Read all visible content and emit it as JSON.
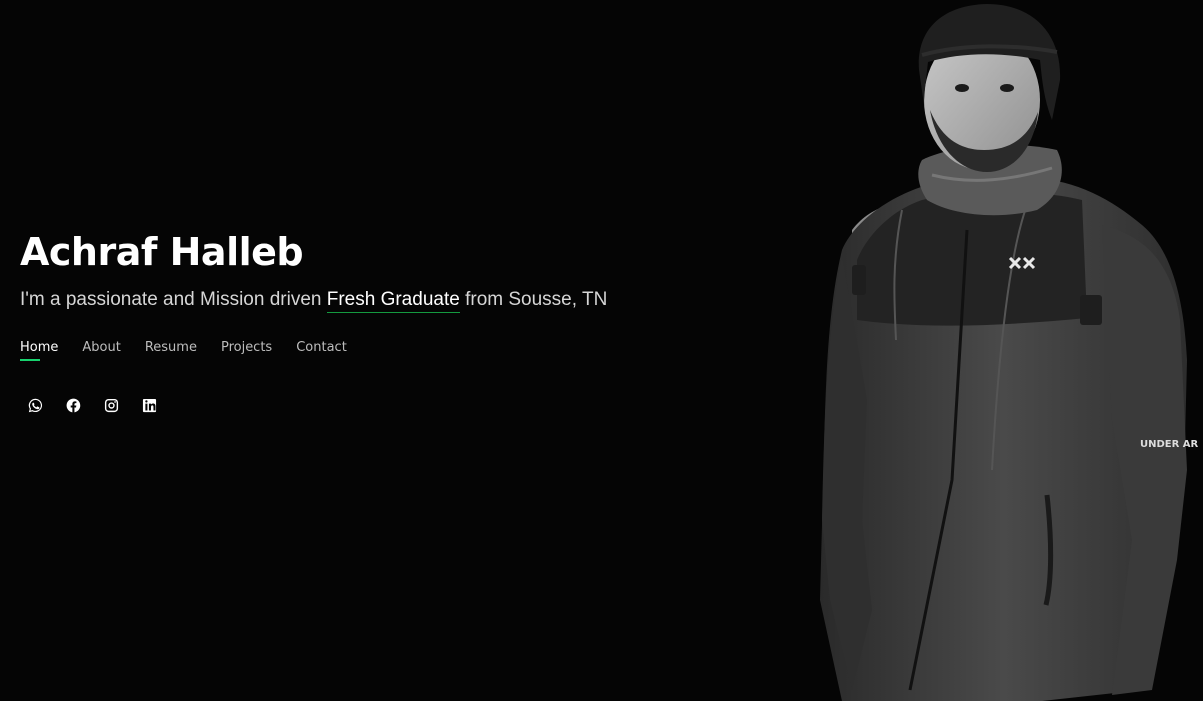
{
  "hero": {
    "name": "Achraf Halleb",
    "tagline_before": "I'm a passionate and Mission driven ",
    "tagline_highlight": "Fresh Graduate",
    "tagline_after": " from Sousse, TN"
  },
  "nav": {
    "items": [
      {
        "label": "Home",
        "active": true
      },
      {
        "label": "About",
        "active": false
      },
      {
        "label": "Resume",
        "active": false
      },
      {
        "label": "Projects",
        "active": false
      },
      {
        "label": "Contact",
        "active": false
      }
    ]
  },
  "social": {
    "icons": [
      "whatsapp-icon",
      "facebook-icon",
      "instagram-icon",
      "linkedin-icon"
    ]
  },
  "portrait": {
    "jacket_text": "UNDER AR"
  },
  "colors": {
    "background": "#050505",
    "accent": "#18d26e",
    "text": "#ffffff",
    "muted_text": "#bdbdbd"
  }
}
